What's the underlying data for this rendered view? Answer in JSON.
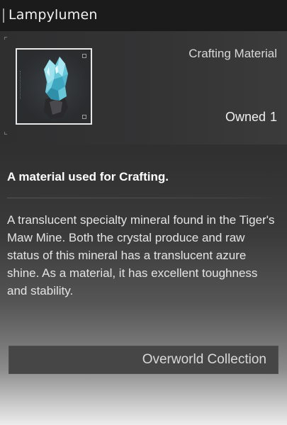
{
  "item": {
    "name": "Lampylumen",
    "category": "Crafting Material",
    "owned_label": "Owned",
    "owned_count": "1",
    "icon": "blue-crystal-icon",
    "summary": "A material used for Crafting.",
    "description": "A translucent specialty mineral found in the Tiger's Maw Mine. Both the crystal produce and raw status of this mineral has a translucent azure shine. As a material, it has excellent toughness and stability.",
    "source_button_label": "Overworld Collection"
  },
  "colors": {
    "crystal": "#6fc4d6",
    "panel_dark": "#2b2b2b",
    "button_bg": "#464647"
  }
}
